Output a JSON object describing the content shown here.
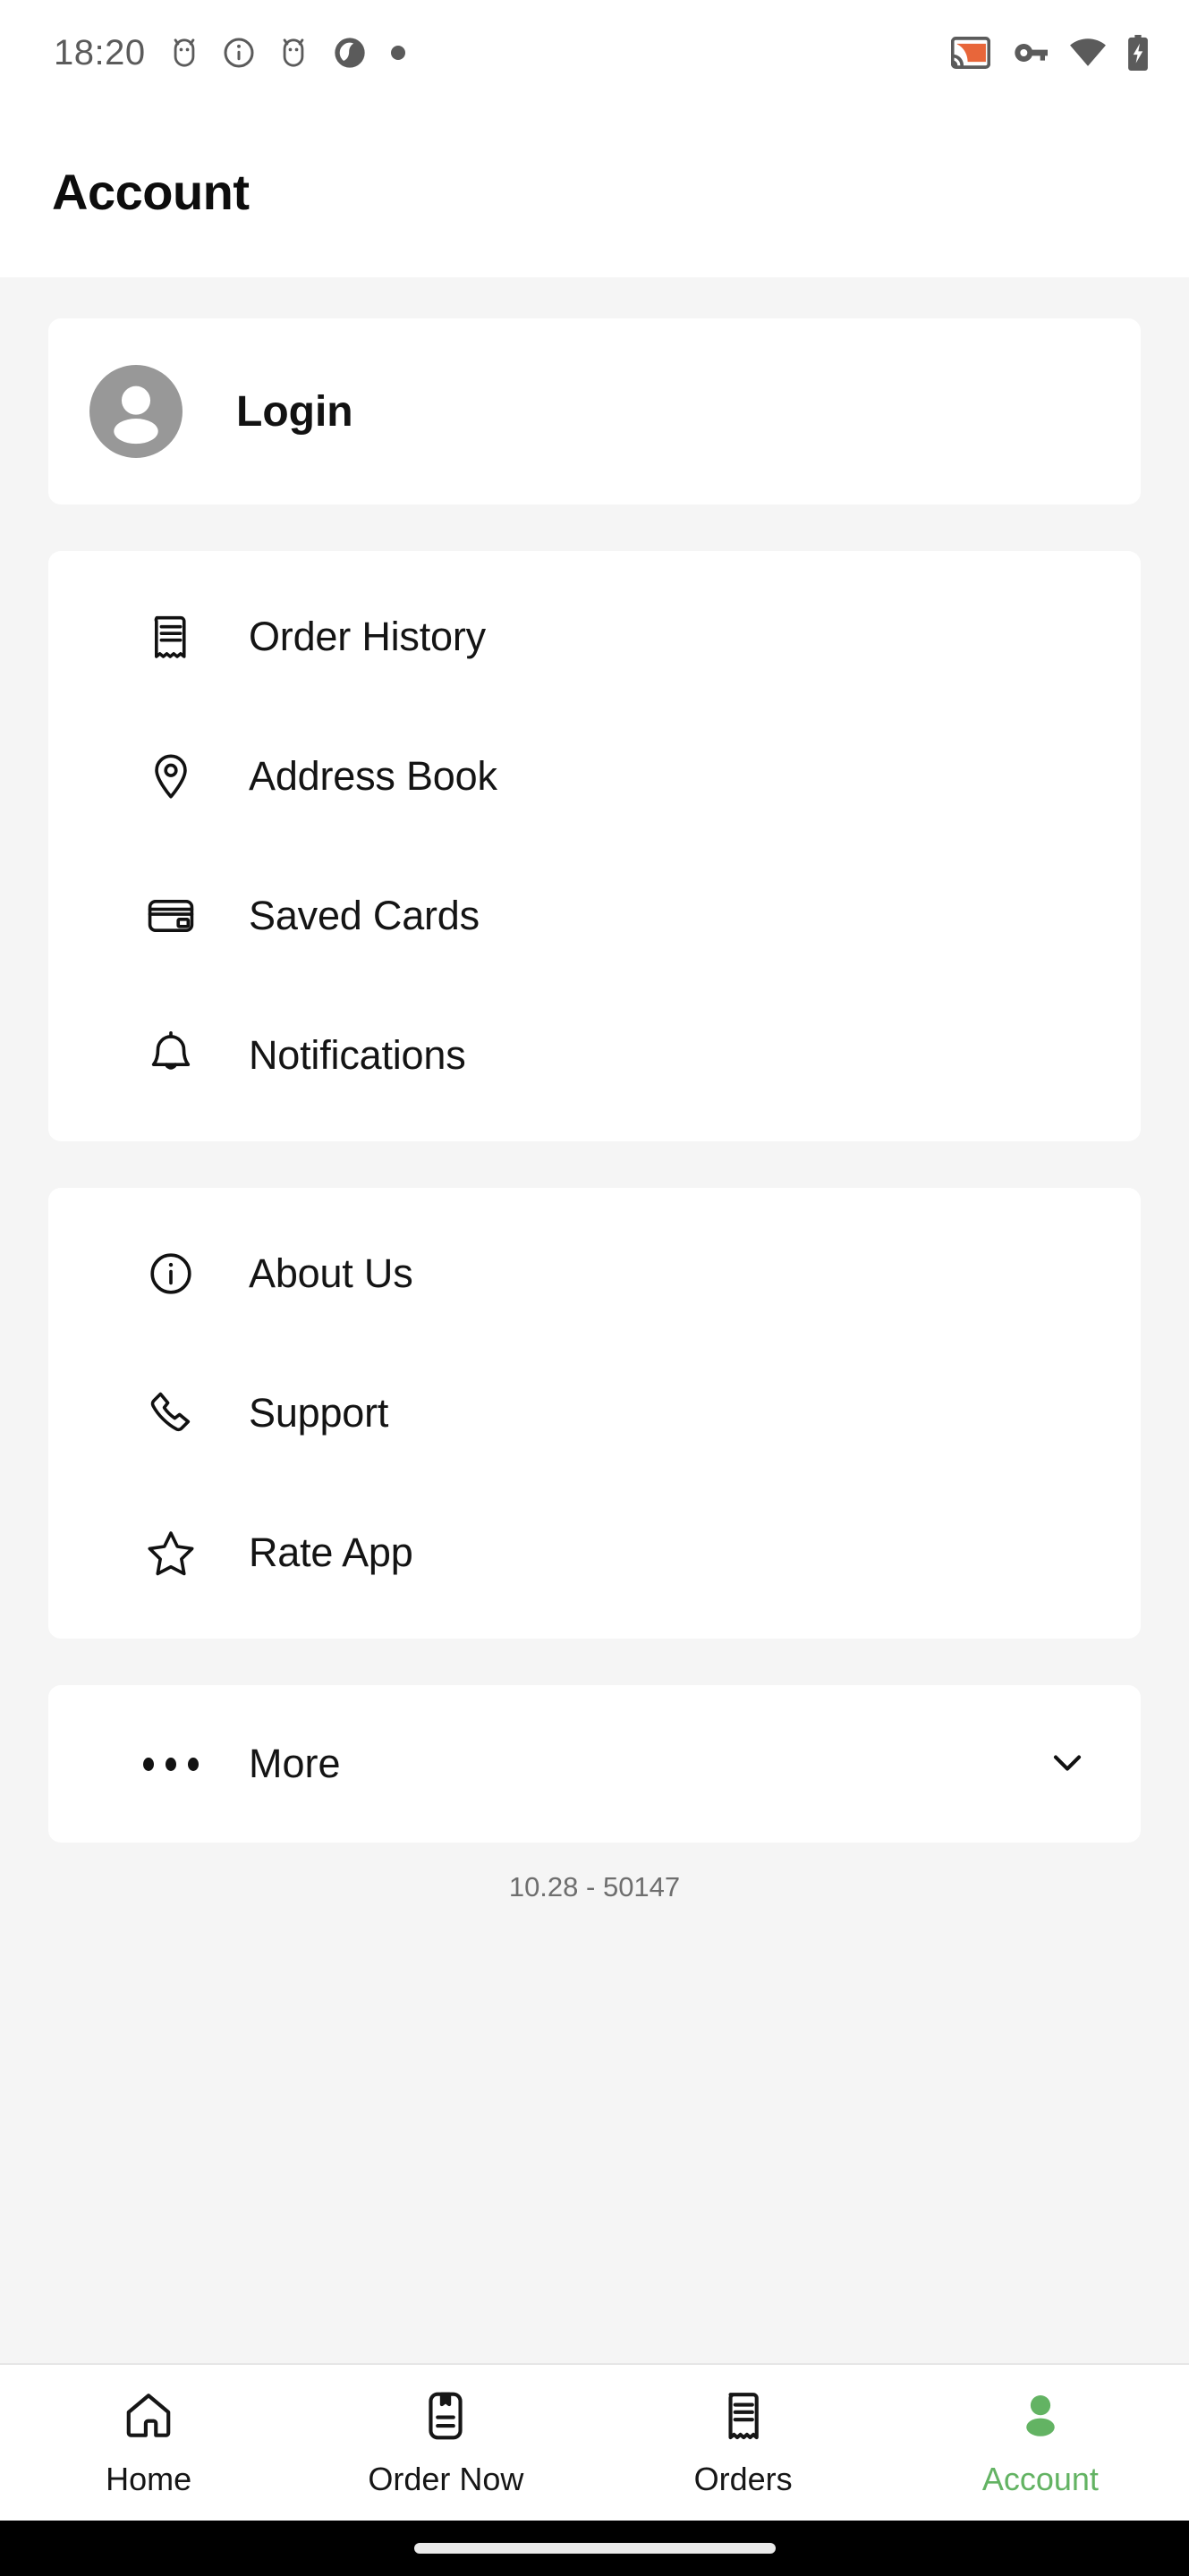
{
  "status_bar": {
    "time": "18:20",
    "left_icons": [
      "android-bug-icon",
      "info-circle-icon",
      "android-bug-icon",
      "aperture-logo-icon",
      "dot-indicator-icon"
    ],
    "right_icons": [
      "cast-icon",
      "vpn-key-icon",
      "wifi-icon",
      "battery-charging-icon"
    ],
    "cast_accent_color": "#E8663A",
    "icon_color": "#5b5b5b"
  },
  "header": {
    "title": "Account"
  },
  "login_card": {
    "label": "Login",
    "avatar_icon": "person-avatar-icon",
    "avatar_color": "#989898"
  },
  "account_menu": {
    "items": [
      {
        "label": "Order History",
        "icon": "receipt-icon"
      },
      {
        "label": "Address Book",
        "icon": "location-pin-icon"
      },
      {
        "label": "Saved Cards",
        "icon": "credit-card-icon"
      },
      {
        "label": "Notifications",
        "icon": "bell-icon"
      }
    ]
  },
  "info_menu": {
    "items": [
      {
        "label": "About Us",
        "icon": "info-circle-icon"
      },
      {
        "label": "Support",
        "icon": "phone-icon"
      },
      {
        "label": "Rate App",
        "icon": "star-icon"
      }
    ]
  },
  "more_card": {
    "label": "More",
    "leading_icon": "ellipsis-icon",
    "trailing_icon": "chevron-down-icon"
  },
  "version": {
    "text": "10.28 - 50147"
  },
  "bottom_nav": {
    "active_color": "#63b363",
    "inactive_color": "#161616",
    "items": [
      {
        "label": "Home",
        "icon": "home-icon",
        "active": false
      },
      {
        "label": "Order Now",
        "icon": "menu-book-icon",
        "active": false
      },
      {
        "label": "Orders",
        "icon": "receipt-icon",
        "active": false
      },
      {
        "label": "Account",
        "icon": "person-icon",
        "active": true
      }
    ]
  }
}
